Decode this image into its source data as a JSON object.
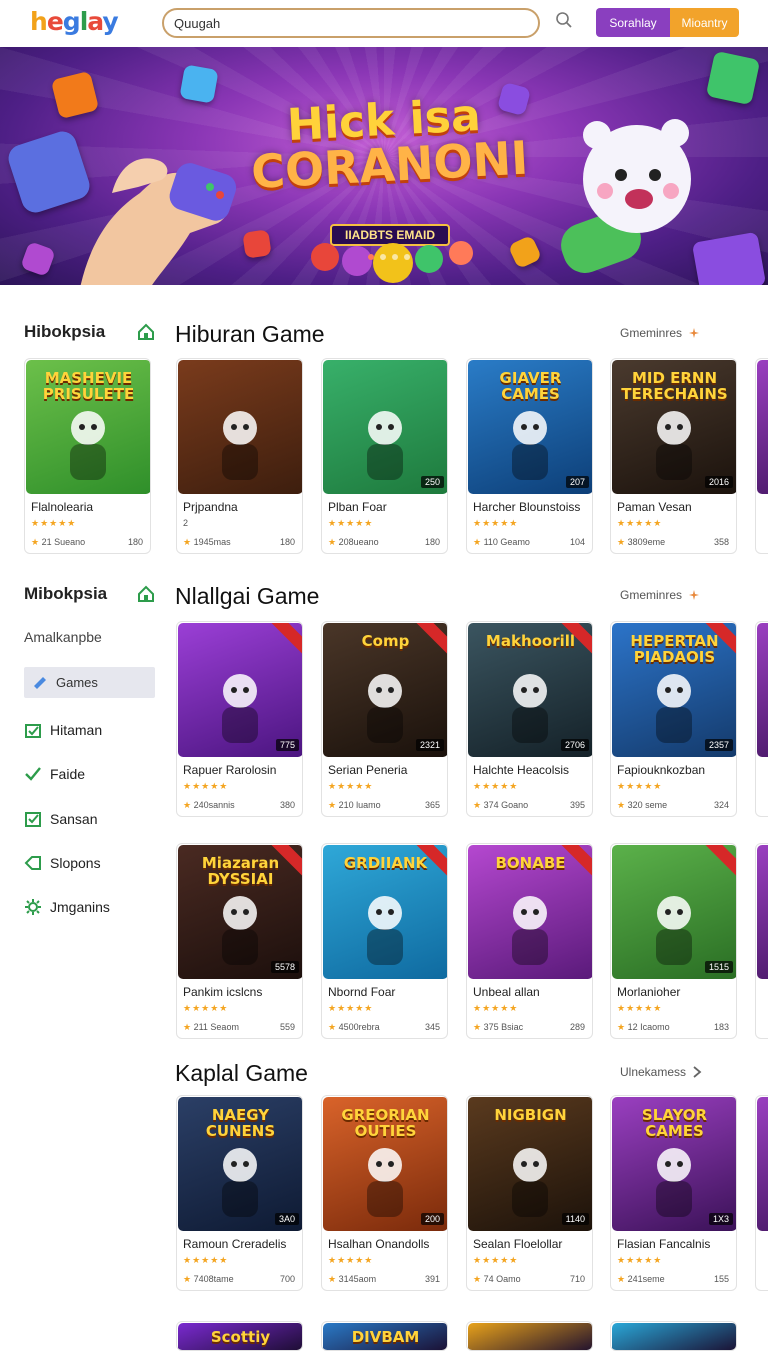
{
  "header": {
    "logo": [
      "h",
      "e",
      "g",
      "l",
      "a",
      "y"
    ],
    "search_value": "Quugah",
    "signup_label": "Sorahlay",
    "login_label": "Mioantry"
  },
  "hero": {
    "title_line1": "Hick isa",
    "title_line2": "CORANONI",
    "subtitle": "IIADBTS EMAID",
    "dots": 4,
    "active_dot": 0
  },
  "sidebar": {
    "section1_title": "Hibokpsia",
    "section2_title": "Mibokpsia",
    "subtitle": "Amalkanpbe",
    "selected": "Games",
    "items": [
      {
        "label": "Hitaman",
        "icon": "box-check-icon"
      },
      {
        "label": "Faide",
        "icon": "check-icon"
      },
      {
        "label": "Sansan",
        "icon": "square-check-icon"
      },
      {
        "label": "Slopons",
        "icon": "tag-icon"
      },
      {
        "label": "Jmganins",
        "icon": "gear-icon"
      }
    ]
  },
  "sections": [
    {
      "title": "Hiburan Game",
      "more": "Gmeminres",
      "cards": [
        {
          "name": "Flalnolearia",
          "meta": "21 Sueano",
          "count": "180",
          "colors": [
            "#6cc04a",
            "#2f8f2a"
          ],
          "thumb_title": "MASHEVIE PRISULETE"
        },
        {
          "name": "Prjpandna",
          "meta": "1945mas",
          "count": "180",
          "colors": [
            "#7a3b1c",
            "#3d1e0e"
          ],
          "thumb_title": "",
          "extra": "2"
        },
        {
          "name": "Plban Foar",
          "meta": "208ueano",
          "count": "180",
          "colors": [
            "#38b06a",
            "#1e7a3d"
          ],
          "thumb_title": "",
          "badge": "250"
        },
        {
          "name": "Harcher Blounstoiss",
          "meta": "110 Geamo",
          "count": "104",
          "colors": [
            "#2a7cc7",
            "#0d3f78"
          ],
          "thumb_title": "GIAVER CAMES",
          "badge": "207"
        },
        {
          "name": "Paman Vesan",
          "meta": "3809eme",
          "count": "358",
          "colors": [
            "#4a3a2e",
            "#1b120c"
          ],
          "thumb_title": "MID ERNN TERECHAINS",
          "badge": "2016"
        }
      ]
    },
    {
      "title": "Nlallgai Game",
      "more": "Gmeminres",
      "cards": [
        {
          "name": "Rapuer Rarolosin",
          "meta": "240sannis",
          "count": "380",
          "colors": [
            "#9b3fd6",
            "#4b1580"
          ],
          "thumb_title": "",
          "badge": "775"
        },
        {
          "name": "Serian Peneria",
          "meta": "210 luamo",
          "count": "365",
          "colors": [
            "#4a3628",
            "#1a110b"
          ],
          "thumb_title": "Comp",
          "badge": "2321"
        },
        {
          "name": "Halchte Heacolsis",
          "meta": "374 Goano",
          "count": "395",
          "colors": [
            "#3b5560",
            "#142128"
          ],
          "thumb_title": "Makhoorill",
          "badge": "2706"
        },
        {
          "name": "Fapiouknkozban",
          "meta": "320 seme",
          "count": "324",
          "colors": [
            "#2c74c9",
            "#143a6b"
          ],
          "thumb_title": "HEPERTAN PIADAOIS",
          "badge": "2357"
        }
      ]
    },
    {
      "title": "",
      "more": "",
      "cards": [
        {
          "name": "Pankim icslcns",
          "meta": "211 Seaom",
          "count": "559",
          "colors": [
            "#4a2a22",
            "#1c0f0c"
          ],
          "thumb_title": "Miazaran DYSSIAI",
          "badge": "5578"
        },
        {
          "name": "Nbornd Foar",
          "meta": "4500rebra",
          "count": "345",
          "colors": [
            "#2fa8d8",
            "#0f6aa0"
          ],
          "thumb_title": "GRDIIANK",
          "badge": ""
        },
        {
          "name": "Unbeal allan",
          "meta": "375 Bsiac",
          "count": "289",
          "colors": [
            "#b548d0",
            "#5a1a7a"
          ],
          "thumb_title": "BONABE",
          "badge": ""
        },
        {
          "name": "Morlanioher",
          "meta": "12 Icaomo",
          "count": "183",
          "colors": [
            "#5bb14a",
            "#2a6e24"
          ],
          "thumb_title": "",
          "badge": "1515"
        }
      ]
    },
    {
      "title": "Kaplal Game",
      "more": "Ulnekamess",
      "cards": [
        {
          "name": "Ramoun Creradelis",
          "meta": "7408tame",
          "count": "700",
          "colors": [
            "#2b3f66",
            "#0e1a33"
          ],
          "thumb_title": "NAEGY CUNENS",
          "badge": "3A0"
        },
        {
          "name": "Hsalhan Onandolls",
          "meta": "3145aom",
          "count": "391",
          "colors": [
            "#d9632a",
            "#7a2a0b"
          ],
          "thumb_title": "GREORIAN OUTIES",
          "badge": "200"
        },
        {
          "name": "Sealan Floelollar",
          "meta": "74 Oamo",
          "count": "710",
          "colors": [
            "#5a3a1e",
            "#1c120a"
          ],
          "thumb_title": "NIGBIGN",
          "badge": "1140"
        },
        {
          "name": "Flasian Fancalnis",
          "meta": "241seme",
          "count": "155",
          "colors": [
            "#9a3fc0",
            "#3b1258"
          ],
          "thumb_title": "SLAYOR CAMES",
          "badge": "1X3"
        }
      ]
    }
  ],
  "bottom_row_titles": [
    "Scottiy",
    "DIVBAM",
    "",
    ""
  ]
}
